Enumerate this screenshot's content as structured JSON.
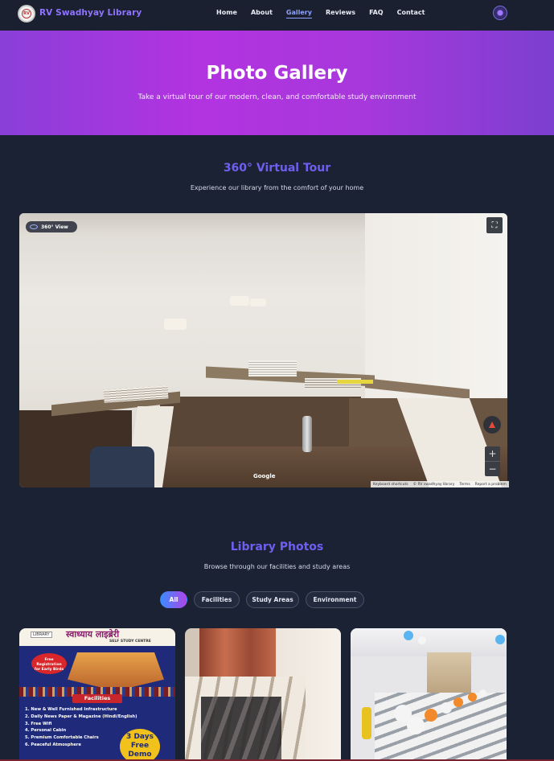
{
  "nav": {
    "brand": "RV Swadhyay Library",
    "logo_text": "RV",
    "links": [
      "Home",
      "About",
      "Gallery",
      "Reviews",
      "FAQ",
      "Contact"
    ],
    "active_link": "Gallery"
  },
  "hero": {
    "title": "Photo Gallery",
    "subtitle": "Take a virtual tour of our modern, clean, and comfortable study environment"
  },
  "tour": {
    "title": "360° Virtual Tour",
    "subtitle": "Experience our library from the comfort of your home",
    "badge": "360° View",
    "google_label": "Google",
    "attribution": [
      "Keyboard shortcuts",
      "© RV swadhyay library",
      "Terms",
      "Report a problem"
    ]
  },
  "photos": {
    "title": "Library Photos",
    "subtitle": "Browse through our facilities and study areas",
    "filters": [
      "All",
      "Facilities",
      "Study Areas",
      "Environment"
    ],
    "active_filter": "All",
    "poster": {
      "library_tag": "LIBRARY",
      "headline": "स्वाध्याय लाइब्रेरी",
      "subline": "SELF STUDY CENTRE",
      "badge_line1": "Free Registration",
      "badge_line2": "for Early Birds",
      "facilities_label": "Facilities",
      "items": [
        "1. New & Well Furnished Infrastructure",
        "2. Daily News Paper & Magazine (Hindi/English)",
        "3. Free Wifi",
        "4. Personal Cabin",
        "5. Premium Comfortable Chairs",
        "6. Peaceful Atmosphere"
      ],
      "offer_line1": "3 Days",
      "offer_line2": "Free",
      "offer_line3": "Demo"
    }
  },
  "colors": {
    "background": "#1b2234",
    "accent": "#6f5ff0",
    "hero_gradient_start": "#8a3fd9",
    "hero_gradient_mid": "#b233e0"
  }
}
